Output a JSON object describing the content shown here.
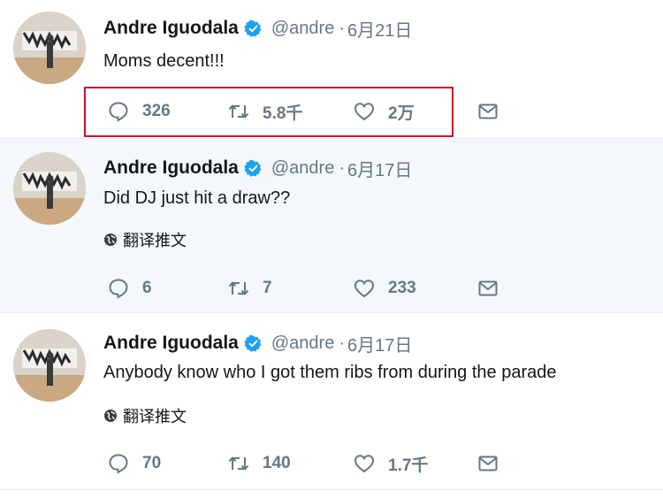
{
  "colors": {
    "verified": "#1da1f2",
    "secondary_text": "#657786",
    "primary_text": "#14171a",
    "highlight_box": "#c8102e",
    "alt_row_bg": "#f5f8fa"
  },
  "icons": {
    "reply": "speech-bubble-icon",
    "retweet": "retweet-arrows-icon",
    "like": "heart-icon",
    "dm": "envelope-icon",
    "translate": "globe-icon",
    "verified": "verified-badge-icon"
  },
  "tweets": [
    {
      "author": "Andre Iguodala",
      "handle": "@andre",
      "separator": "·",
      "date": "6月21日",
      "text": "Moms decent!!!",
      "translate_label": "",
      "replies": "326",
      "retweets": "5.8千",
      "likes": "2万"
    },
    {
      "author": "Andre Iguodala",
      "handle": "@andre",
      "separator": "·",
      "date": "6月17日",
      "text": "Did DJ just hit a draw??",
      "translate_label": "翻译推文",
      "replies": "6",
      "retweets": "7",
      "likes": "233"
    },
    {
      "author": "Andre Iguodala",
      "handle": "@andre",
      "separator": "·",
      "date": "6月17日",
      "text": "Anybody know who I got them ribs from during the parade",
      "translate_label": "翻译推文",
      "replies": "70",
      "retweets": "140",
      "likes": "1.7千"
    }
  ]
}
